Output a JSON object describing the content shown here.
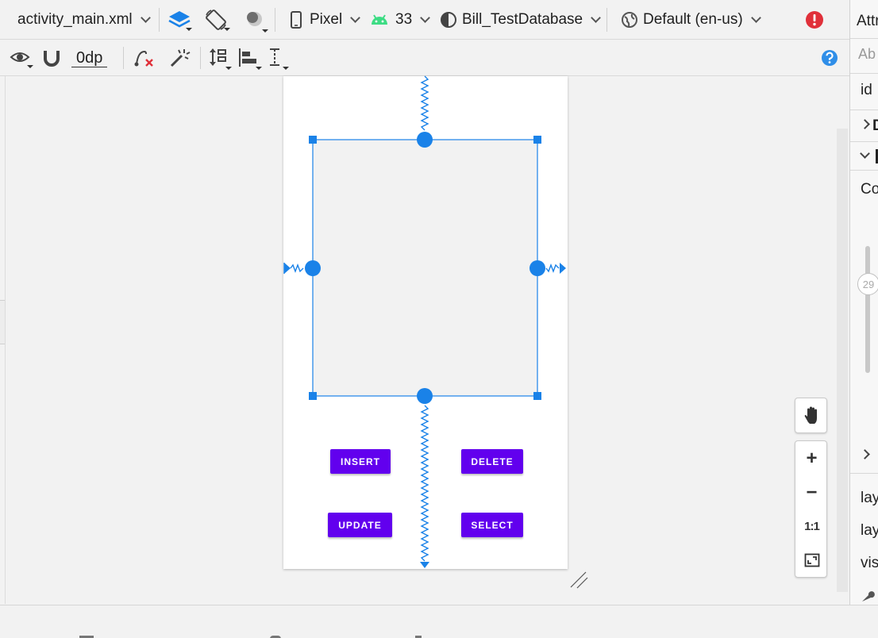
{
  "toolbar": {
    "file_tab": "activity_main.xml",
    "device": "Pixel",
    "api_level": "33",
    "theme": "Bill_TestDatabase",
    "locale": "Default (en-us)",
    "margin_value": "0dp"
  },
  "right_panel": {
    "header": "Attr",
    "search_hint": "Ab",
    "id_label": "id",
    "section_d": "D",
    "section_constraint_partial": "Co",
    "slider_value": "29",
    "layout_rows": [
      "lay",
      "lay",
      "vis"
    ]
  },
  "layout_buttons": {
    "insert": "INSERT",
    "delete": "DELETE",
    "update": "UPDATE",
    "select": "SELECT"
  },
  "zoom": {
    "actual_size": "1:1"
  },
  "colors": {
    "accent": "#1a82e8",
    "button_purple": "#6200ee",
    "error_red": "#e0303a",
    "help_blue": "#2f8ee8",
    "android_green": "#3ddc84"
  },
  "icons": [
    "layers-icon",
    "orientation-icon",
    "night-mode-icon",
    "phone-icon",
    "android-icon",
    "theme-icon",
    "globe-icon",
    "error-icon",
    "eye-icon",
    "magnet-icon",
    "clear-constraints-icon",
    "infer-constraints-icon",
    "pack-icon",
    "align-icon",
    "guidelines-icon",
    "help-icon",
    "pan-icon",
    "zoom-in-icon",
    "zoom-out-icon",
    "zoom-to-fit-icon",
    "resize-handle-icon",
    "wrench-icon"
  ]
}
